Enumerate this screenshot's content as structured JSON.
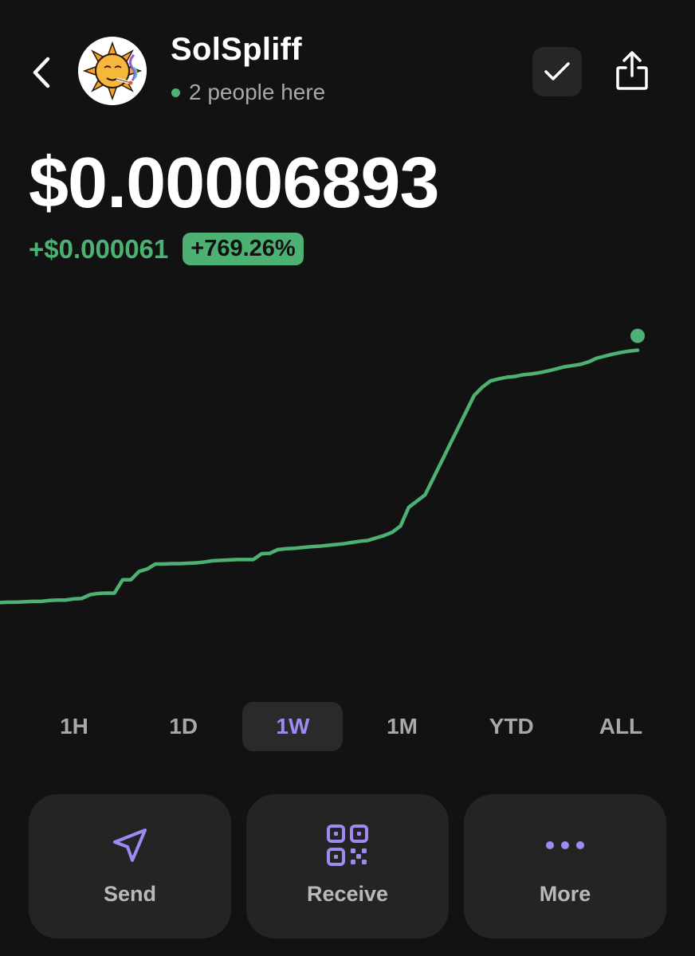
{
  "header": {
    "token_name": "SolSpliff",
    "presence_text": "2 people here",
    "icons": {
      "back": "chevron-left-icon",
      "avatar": "sun-smoking-logo",
      "check": "checkmark-icon",
      "share": "share-icon"
    }
  },
  "price": {
    "current": "$0.00006893",
    "change_abs": "+$0.000061",
    "change_pct": "+769.26%"
  },
  "chart_data": {
    "type": "line",
    "color": "#4cb173",
    "x": [
      0,
      1,
      2,
      3,
      4,
      5,
      6,
      7,
      8,
      9,
      10,
      11,
      12,
      13,
      14,
      15,
      16,
      17,
      18,
      19,
      20,
      21,
      22,
      23,
      24,
      25,
      26,
      27,
      28,
      29,
      30,
      31,
      32,
      33,
      34,
      35,
      36,
      37,
      38,
      39,
      40,
      41,
      42,
      43,
      44,
      45,
      46,
      47,
      48,
      49,
      50,
      51,
      52,
      53,
      54,
      55,
      56,
      57,
      58,
      59,
      60,
      61,
      62,
      63,
      64,
      65,
      66,
      67,
      68,
      69,
      70,
      71,
      72,
      73,
      74,
      75,
      76,
      77,
      78
    ],
    "values": [
      8.0,
      8.1,
      8.1,
      8.2,
      8.3,
      8.3,
      8.5,
      8.6,
      8.6,
      8.9,
      9.0,
      9.9,
      10.2,
      10.3,
      10.3,
      13.5,
      13.5,
      15.5,
      16.1,
      17.3,
      17.3,
      17.4,
      17.4,
      17.5,
      17.6,
      17.8,
      18.1,
      18.2,
      18.3,
      18.4,
      18.4,
      18.4,
      19.8,
      19.9,
      20.8,
      21.0,
      21.1,
      21.3,
      21.5,
      21.6,
      21.8,
      22.0,
      22.2,
      22.5,
      22.8,
      23.0,
      23.6,
      24.2,
      25.0,
      26.5,
      31.0,
      32.5,
      34.0,
      38.0,
      42.0,
      46.0,
      50.0,
      54.0,
      58.0,
      60.0,
      61.5,
      62.0,
      62.4,
      62.6,
      63.0,
      63.2,
      63.5,
      63.9,
      64.4,
      64.9,
      65.2,
      65.5,
      66.1,
      67.0,
      67.5,
      68.0,
      68.4,
      68.7,
      68.93
    ],
    "ylim": [
      0,
      75
    ],
    "end_marker": true
  },
  "time_ranges": {
    "items": [
      "1H",
      "1D",
      "1W",
      "1M",
      "YTD",
      "ALL"
    ],
    "active": "1W"
  },
  "actions": [
    {
      "label": "Send",
      "icon": "paper-plane-icon"
    },
    {
      "label": "Receive",
      "icon": "qr-code-icon"
    },
    {
      "label": "More",
      "icon": "more-dots-icon"
    }
  ],
  "colors": {
    "background": "#121212",
    "positive": "#4cb173",
    "accent": "#a08af2",
    "card": "#242424"
  }
}
